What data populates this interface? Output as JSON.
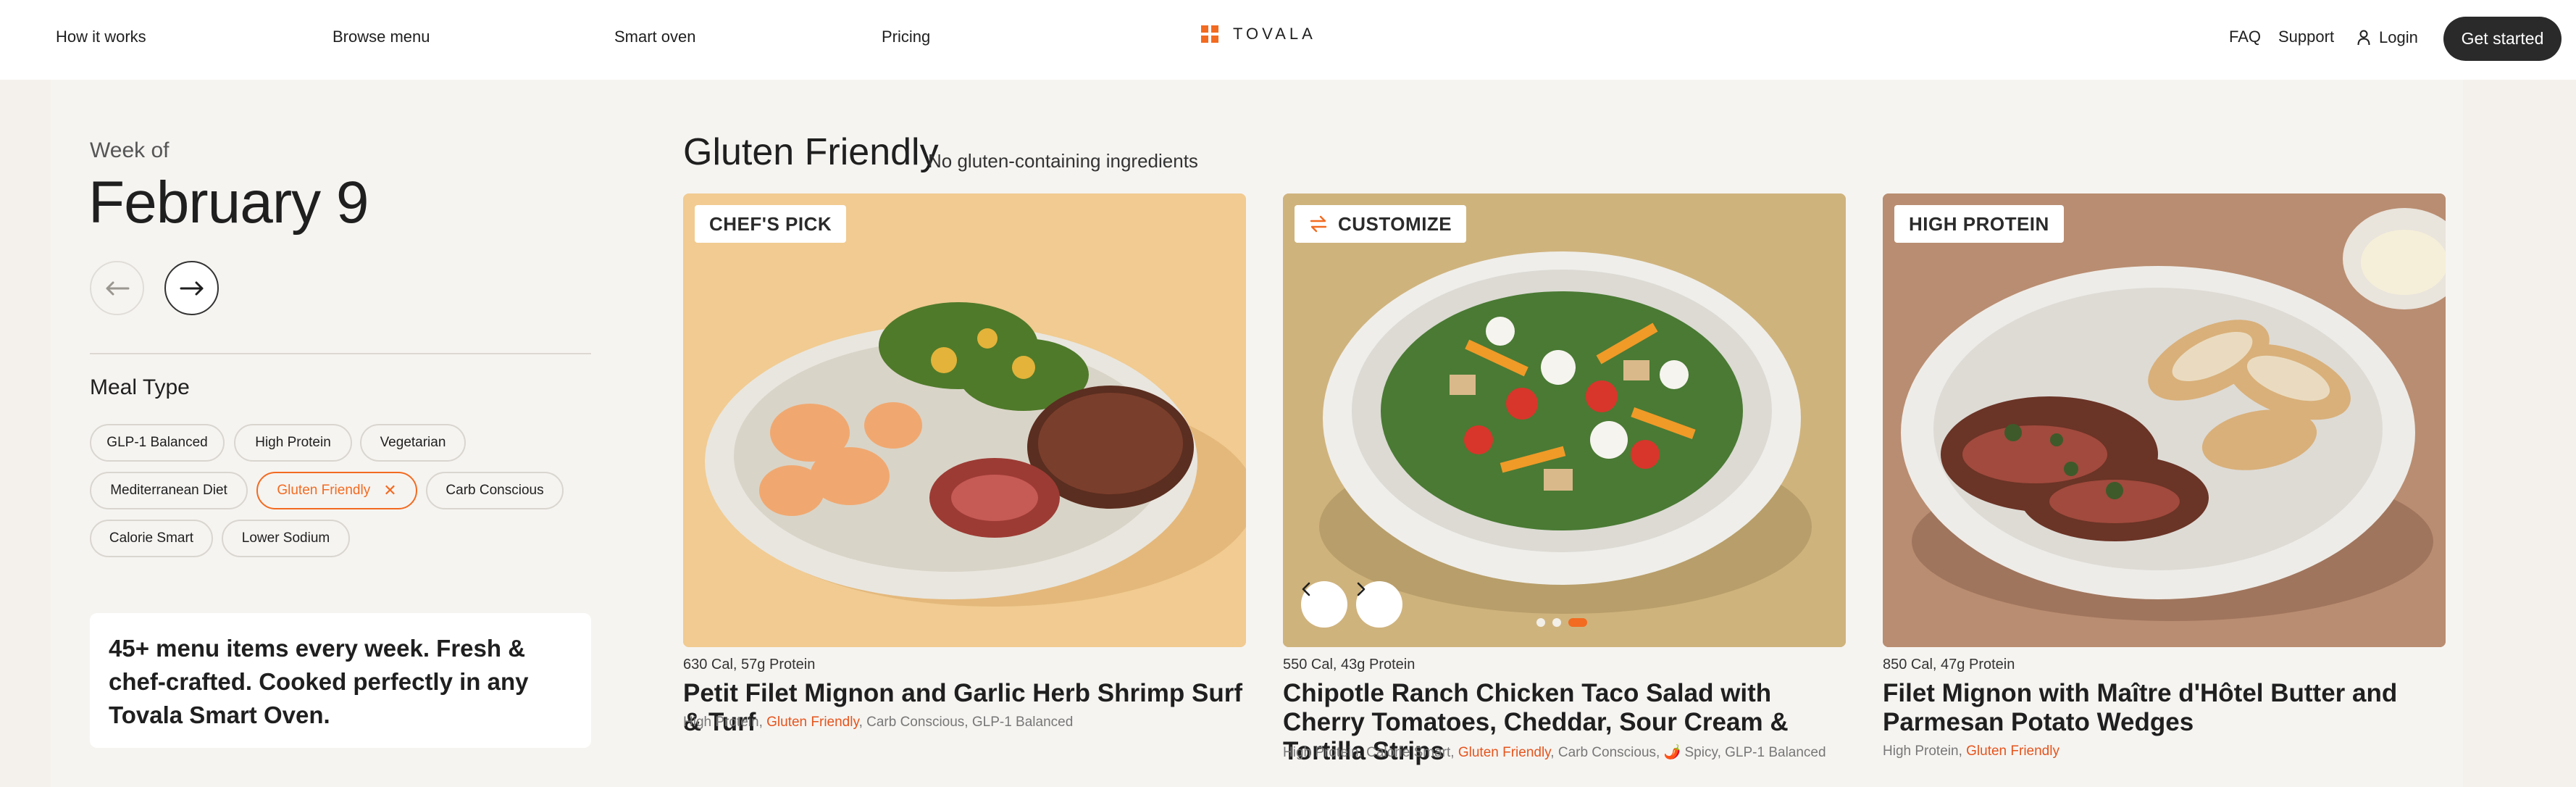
{
  "nav": {
    "left_links": [
      "How it works",
      "Browse menu",
      "Smart oven",
      "Pricing"
    ],
    "logo_text": "TOVALA",
    "right_links": [
      "FAQ",
      "Support"
    ],
    "login": "Login",
    "cta": "Get started"
  },
  "sidebar": {
    "week_of": "Week of",
    "week_date": "February 9",
    "meal_type_heading": "Meal Type",
    "filters": [
      {
        "label": "GLP-1 Balanced",
        "active": false
      },
      {
        "label": "High Protein",
        "active": false
      },
      {
        "label": "Vegetarian",
        "active": false
      },
      {
        "label": "Mediterranean Diet",
        "active": false
      },
      {
        "label": "Gluten Friendly",
        "active": true
      },
      {
        "label": "Carb Conscious",
        "active": false
      },
      {
        "label": "Calorie Smart",
        "active": false
      },
      {
        "label": "Lower Sodium",
        "active": false
      }
    ],
    "promo": "45+ menu items every week. Fresh & chef-crafted. Cooked perfectly in any Tovala Smart Oven."
  },
  "section": {
    "title": "Gluten Friendly",
    "subtitle": "No gluten-containing ingredients"
  },
  "cards": [
    {
      "badge": "CHEF'S PICK",
      "nutrition": "630 Cal, 57g Protein",
      "title": "Petit Filet Mignon and Garlic Herb Shrimp Surf & Turf",
      "tags": [
        {
          "text": "High Protein",
          "highlight": false
        },
        {
          "text": "Gluten Friendly",
          "highlight": true
        },
        {
          "text": "Carb Conscious",
          "highlight": false
        },
        {
          "text": "GLP-1 Balanced",
          "highlight": false
        }
      ]
    },
    {
      "badge": "CUSTOMIZE",
      "nutrition": "550 Cal, 43g Protein",
      "title": "Chipotle Ranch Chicken Taco Salad with Cherry Tomatoes, Cheddar, Sour Cream & Tortilla Strips",
      "tags": [
        {
          "text": "High Protein",
          "highlight": false
        },
        {
          "text": "Calorie Smart",
          "highlight": false
        },
        {
          "text": "Gluten Friendly",
          "highlight": true
        },
        {
          "text": "Carb Conscious",
          "highlight": false
        },
        {
          "text": "🌶️ Spicy",
          "highlight": false
        },
        {
          "text": "GLP-1 Balanced",
          "highlight": false
        }
      ]
    },
    {
      "badge": "HIGH PROTEIN",
      "nutrition": "850 Cal, 47g Protein",
      "title": "Filet Mignon with Maître d'Hôtel Butter and Parmesan Potato Wedges",
      "tags": [
        {
          "text": "High Protein",
          "highlight": false
        },
        {
          "text": "Gluten Friendly",
          "highlight": true
        }
      ]
    }
  ],
  "carousel": {
    "slide_count": 3,
    "active_slide": 3
  },
  "colors": {
    "accent": "#f26b21",
    "dark": "#2a2a2a",
    "page_bg": "#f4f1ec"
  },
  "icons": {
    "prev": "arrow-left-icon",
    "next": "arrow-right-icon",
    "login": "user-icon",
    "customize": "swap-icon",
    "remove_filter": "close-icon"
  }
}
